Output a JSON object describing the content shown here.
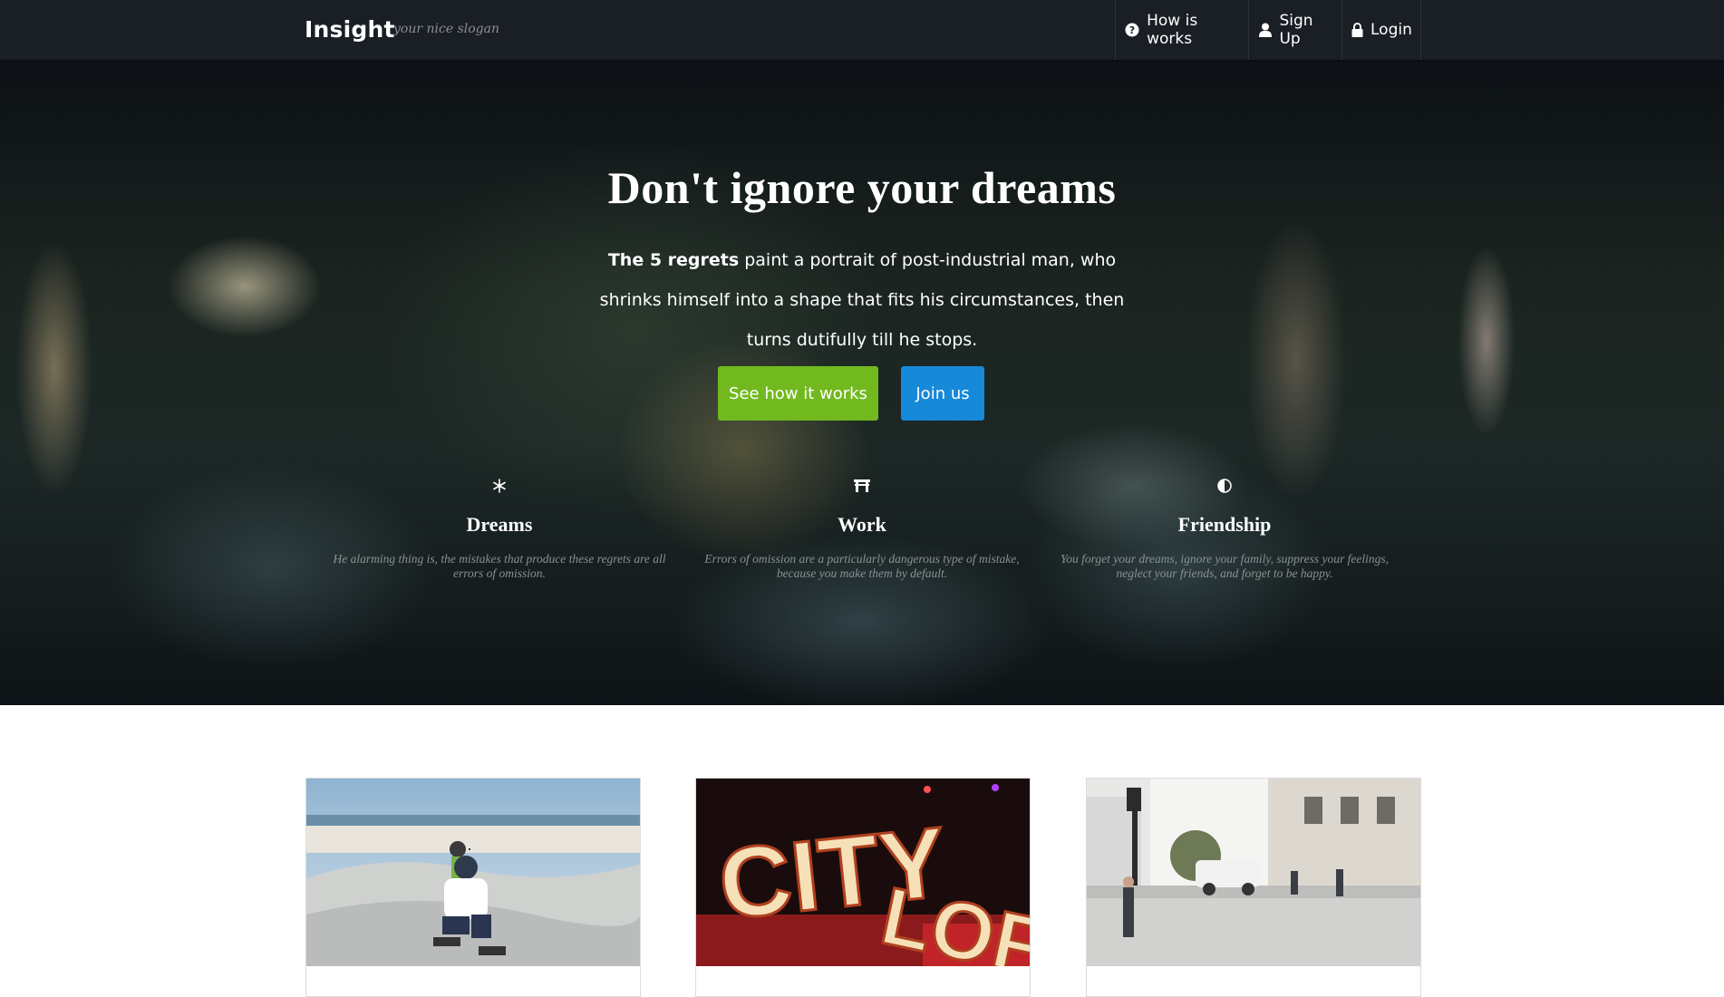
{
  "navbar": {
    "brand": "Insight",
    "slogan": "your nice slogan",
    "items": [
      {
        "label": "How is works",
        "icon": "question-circle-icon"
      },
      {
        "label": "Sign Up",
        "icon": "user-icon"
      },
      {
        "label": "Login",
        "icon": "lock-icon"
      }
    ]
  },
  "hero": {
    "title": "Don't ignore your dreams",
    "lead_strong": "The 5 regrets",
    "lead_rest": "paint a portrait of post-industrial man, who shrinks himself into a shape that fits his circumstances, then turns dutifully till he stops.",
    "buttons": {
      "primary": "See how it works",
      "secondary": "Join us"
    },
    "features": [
      {
        "icon": "snowflake-icon",
        "title": "Dreams",
        "text": "He alarming thing is, the mistakes that produce these regrets are all errors of omission."
      },
      {
        "icon": "bank-icon",
        "title": "Work",
        "text": "Errors of omission are a particularly dangerous type of mistake, because you make them by default."
      },
      {
        "icon": "half-circle-icon",
        "title": "Friendship",
        "text": "You forget your dreams, ignore your family, suppress your feelings, neglect your friends, and forget to be happy."
      }
    ]
  },
  "cards": [
    {
      "image": "skatepark-photo"
    },
    {
      "image": "city-loft-sign-photo"
    },
    {
      "image": "street-crosswalk-photo"
    }
  ],
  "colors": {
    "navbar_bg": "#1a1e25",
    "primary_button": "#72b91f",
    "secondary_button": "#1689d8"
  }
}
